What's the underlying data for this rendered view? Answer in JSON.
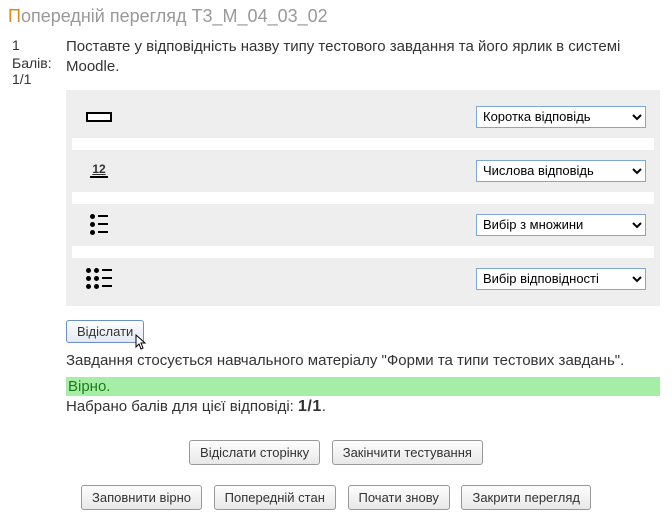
{
  "title_prefix": "П",
  "title_rest": "опередній перегляд Т3_М_04_03_02",
  "question_number": "1",
  "marks_label": "Балів:",
  "marks_value": "1/1",
  "question_text": "Поставте у відповідність назву типу тестового завдання та його ярлик в системі Moodle.",
  "rows": [
    {
      "icon": "shortanswer",
      "selected": "Коротка відповідь"
    },
    {
      "icon": "numerical",
      "selected": "Числова відповідь"
    },
    {
      "icon": "multichoice",
      "selected": "Вибір з множини"
    },
    {
      "icon": "match",
      "selected": "Вибір відповідності"
    }
  ],
  "numerical_glyph": "12",
  "submit_label": "Відіслати",
  "task_note": "Завдання стосується навчального матеріалу \"Форми та типи тестових завдань\".",
  "feedback": "Вірно.",
  "score_prefix": "Набрано балів для цієї відповіді: ",
  "score_value": "1/1",
  "score_suffix": ".",
  "buttons_primary": [
    "Відіслати сторінку",
    "Закінчити тестування"
  ],
  "buttons_secondary": [
    "Заповнити вірно",
    "Попередній стан",
    "Почати знову",
    "Закрити перегляд"
  ]
}
